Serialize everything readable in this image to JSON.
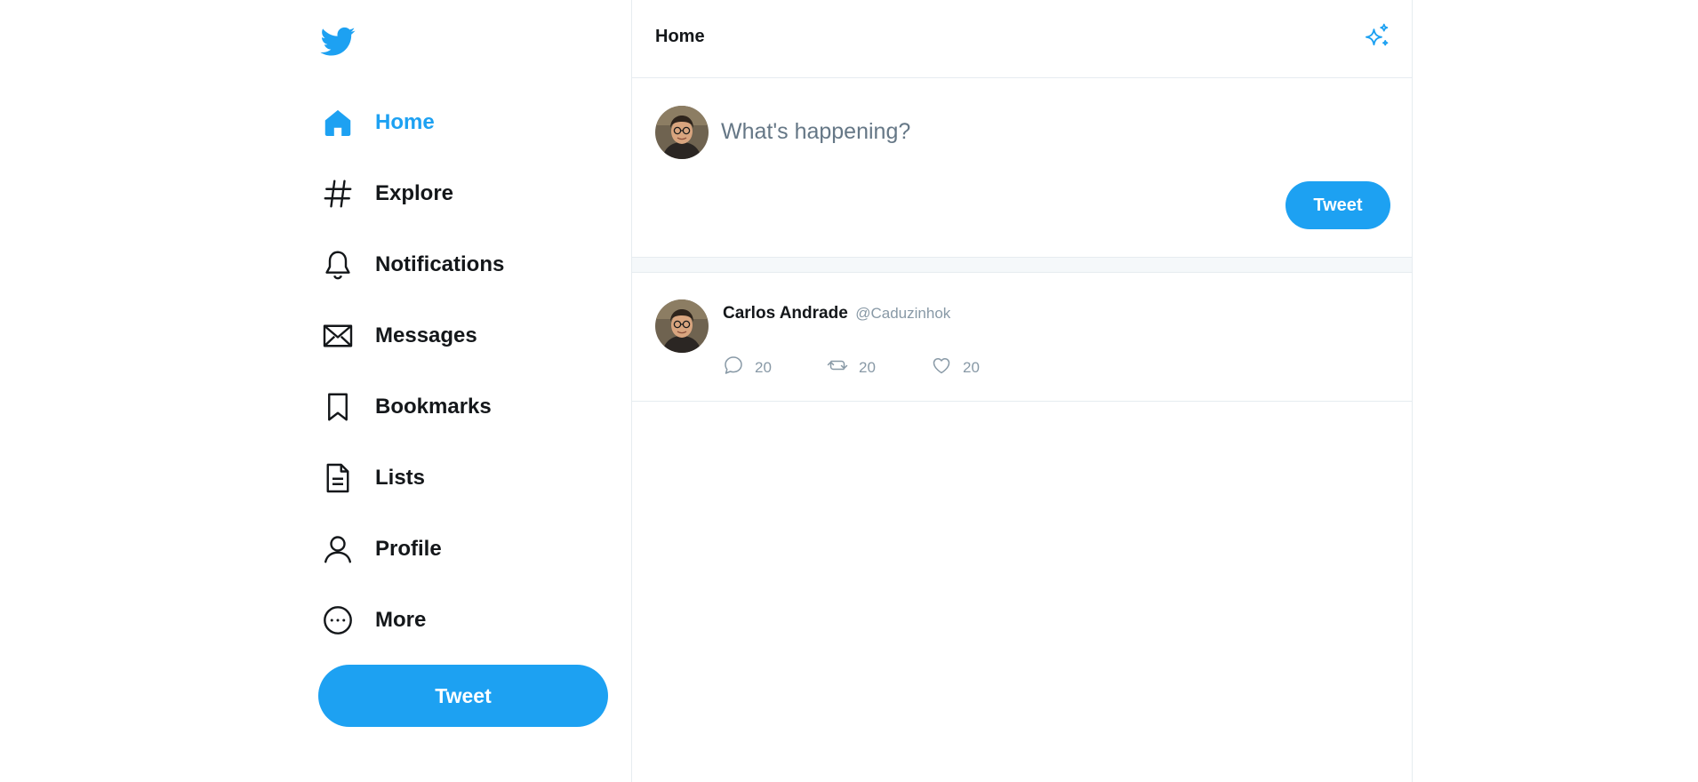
{
  "sidebar": {
    "logo": "twitter-bird-icon",
    "items": [
      {
        "label": "Home",
        "icon": "home-icon",
        "active": true
      },
      {
        "label": "Explore",
        "icon": "hashtag-icon"
      },
      {
        "label": "Notifications",
        "icon": "bell-icon"
      },
      {
        "label": "Messages",
        "icon": "envelope-icon"
      },
      {
        "label": "Bookmarks",
        "icon": "bookmark-icon"
      },
      {
        "label": "Lists",
        "icon": "list-document-icon"
      },
      {
        "label": "Profile",
        "icon": "user-icon"
      },
      {
        "label": "More",
        "icon": "more-circle-icon"
      }
    ],
    "tweet_button": "Tweet"
  },
  "header": {
    "title": "Home",
    "action_icon": "sparkle-icon"
  },
  "composer": {
    "placeholder": "What's happening?",
    "tweet_button": "Tweet"
  },
  "feed": [
    {
      "name": "Carlos Andrade",
      "handle": "@Caduzinhok",
      "replies": "20",
      "retweets": "20",
      "likes": "20"
    }
  ],
  "colors": {
    "accent": "#1da1f2",
    "text": "#14171a",
    "muted": "#8899a6",
    "border": "#e6ecf0"
  }
}
